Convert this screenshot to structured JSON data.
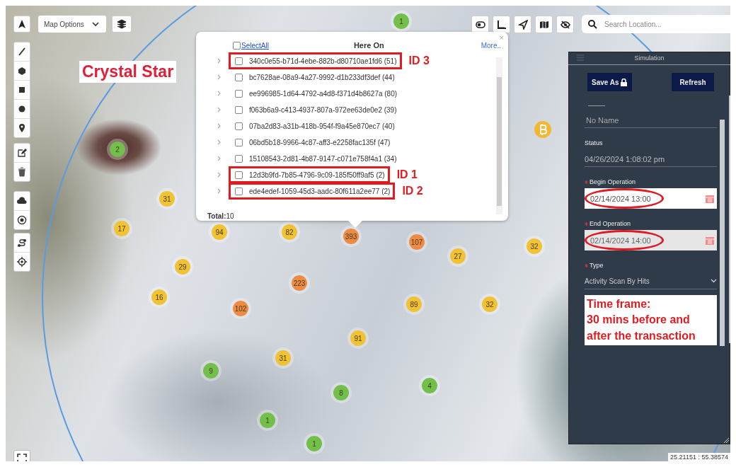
{
  "toolbar": {
    "options_label": "Map Options"
  },
  "search": {
    "placeholder": "Search Location..."
  },
  "annotation_label": "Crystal Star",
  "clusters": [
    {
      "label": "1",
      "color": "#72bf4a"
    },
    {
      "label": "2",
      "color": "#72bf4a"
    },
    {
      "label": "31",
      "color": "#f1c232"
    },
    {
      "label": "17",
      "color": "#f1c232"
    },
    {
      "label": "94",
      "color": "#f1c232"
    },
    {
      "label": "82",
      "color": "#f1c232"
    },
    {
      "label": "393",
      "color": "#ee8c45"
    },
    {
      "label": "107",
      "color": "#ee8c45"
    },
    {
      "label": "32",
      "color": "#f1c232"
    },
    {
      "label": "27",
      "color": "#f1c232"
    },
    {
      "label": "29",
      "color": "#f1c232"
    },
    {
      "label": "223",
      "color": "#ee8c45"
    },
    {
      "label": "16",
      "color": "#f1c232"
    },
    {
      "label": "89",
      "color": "#f1c232"
    },
    {
      "label": "32",
      "color": "#f1c232"
    },
    {
      "label": "102",
      "color": "#ee8c45"
    },
    {
      "label": "91",
      "color": "#f1c232"
    },
    {
      "label": "31",
      "color": "#f1c232"
    },
    {
      "label": "9",
      "color": "#72bf4a"
    },
    {
      "label": "4",
      "color": "#72bf4a"
    },
    {
      "label": "8",
      "color": "#72bf4a"
    },
    {
      "label": "1",
      "color": "#72bf4a"
    },
    {
      "label": "1",
      "color": "#72bf4a"
    }
  ],
  "popup": {
    "select_all": "SelectAll",
    "select_all_checked": false,
    "title": "Here On",
    "more": "More..",
    "close": "×",
    "rows": [
      {
        "text": "340c0e55-b71d-4ebe-882b-d80710ae1fd6 (51)",
        "checked": false,
        "highlighted": true,
        "tag": "ID 3"
      },
      {
        "text": "bc7628ae-08a9-4a27-9992-d1b233df3def (44)",
        "checked": false,
        "highlighted": false
      },
      {
        "text": "ee996985-1d64-4792-a4d8-f371d4b8627a (80)",
        "checked": false,
        "highlighted": false
      },
      {
        "text": "f063b6a9-c413-4937-807a-972ee63de0e2 (39)",
        "checked": false,
        "highlighted": false
      },
      {
        "text": "07ba2d83-a31b-418b-954f-f9a45e870ec7 (40)",
        "checked": false,
        "highlighted": false
      },
      {
        "text": "06bd5b18-9966-4c87-aff3-e2258fac135f (47)",
        "checked": false,
        "highlighted": false
      },
      {
        "text": "15108543-2d81-4b87-9147-c071e758f4a1 (34)",
        "checked": false,
        "highlighted": false
      },
      {
        "text": "12d3b9fd-7b85-4796-9c09-185f50ff9af5 (2)",
        "checked": false,
        "highlighted": true,
        "tag": "ID 1"
      },
      {
        "text": "ede4edef-1059-45d3-aadc-80f611a2ee77 (2)",
        "checked": false,
        "highlighted": true,
        "tag": "ID 2"
      }
    ],
    "total": "**Total:**10"
  },
  "panel": {
    "title": "Simulation",
    "buttons": [
      {
        "label": "Save As",
        "kind": "save"
      },
      {
        "label": "Refresh",
        "kind": "plain"
      }
    ],
    "name_field": {
      "placeholder": "No Name"
    },
    "status_label": "Status",
    "status_value": "04/26/2024 1:08:02 pm",
    "fields": [
      {
        "kind": "date",
        "label": "Begin Operation",
        "required": true,
        "value": "02/14/2024 13:00",
        "circled": true,
        "disabled": false
      },
      {
        "kind": "date",
        "label": "End Operation",
        "required": true,
        "value": "02/14/2024 14:00",
        "circled": true,
        "disabled": true
      },
      {
        "kind": "select",
        "label": "Type",
        "required": true,
        "value": "Activity Scan By Hits"
      }
    ],
    "note": "Time frame:\n30 mins before and\nafter the transaction"
  },
  "coordinates": "25.21151 : 55.38574"
}
